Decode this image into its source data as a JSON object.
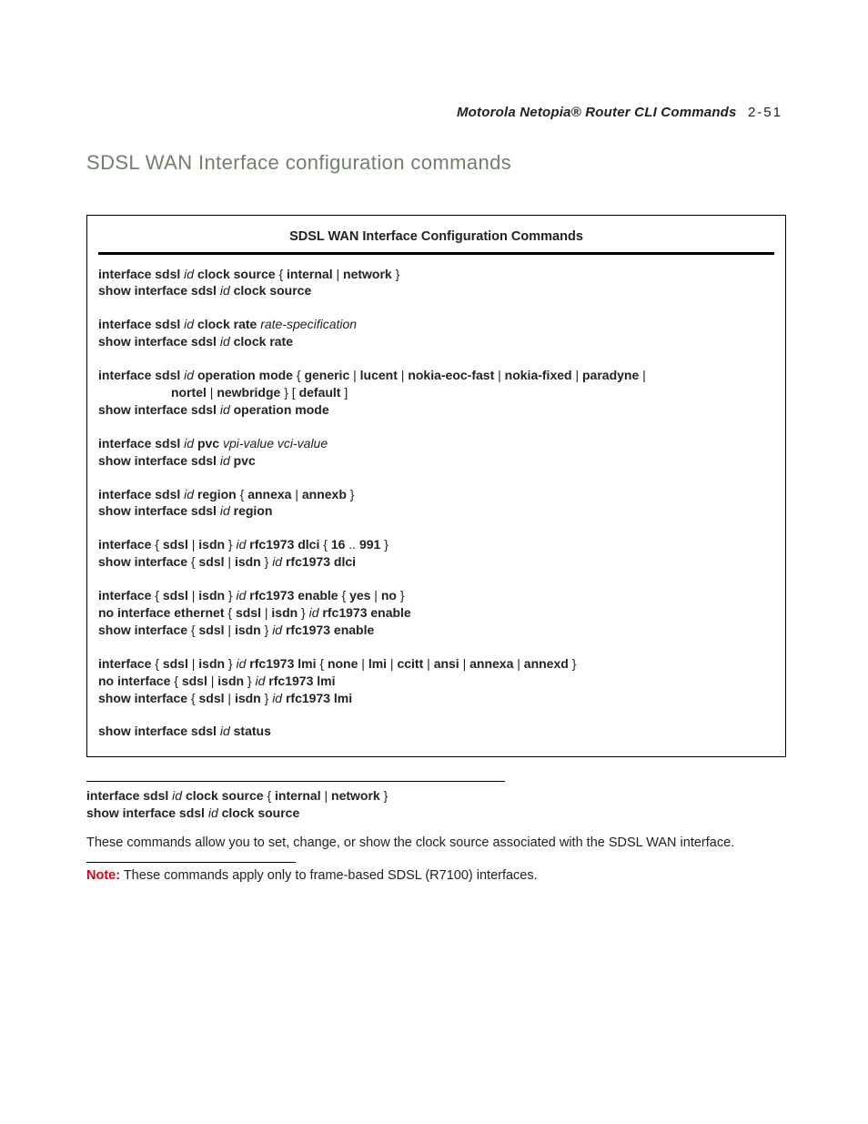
{
  "header": {
    "running": "Motorola Netopia® Router CLI Commands",
    "pagenum": "2-51"
  },
  "heading": "SDSL WAN Interface configuration commands",
  "box": {
    "title": "SDSL WAN Interface Configuration Commands",
    "groups": [
      [
        {
          "segs": [
            [
              "b",
              "interface sdsl "
            ],
            [
              "i",
              "id"
            ],
            [
              "b",
              " clock source "
            ],
            [
              "t",
              "{ "
            ],
            [
              "b",
              "internal"
            ],
            [
              "t",
              " | "
            ],
            [
              "b",
              "network"
            ],
            [
              "t",
              " }"
            ]
          ]
        },
        {
          "segs": [
            [
              "b",
              "show interface sdsl "
            ],
            [
              "i",
              "id"
            ],
            [
              "b",
              " clock source"
            ]
          ]
        }
      ],
      [
        {
          "segs": [
            [
              "b",
              "interface sdsl "
            ],
            [
              "i",
              "id"
            ],
            [
              "b",
              " clock rate "
            ],
            [
              "i",
              "rate-specification"
            ]
          ]
        },
        {
          "segs": [
            [
              "b",
              "show interface sdsl "
            ],
            [
              "i",
              "id"
            ],
            [
              "b",
              " clock rate"
            ]
          ]
        }
      ],
      [
        {
          "segs": [
            [
              "b",
              "interface sdsl "
            ],
            [
              "i",
              "id"
            ],
            [
              "b",
              " operation mode "
            ],
            [
              "t",
              "{ "
            ],
            [
              "b",
              "generic"
            ],
            [
              "t",
              " | "
            ],
            [
              "b",
              "lucent"
            ],
            [
              "t",
              " | "
            ],
            [
              "b",
              "nokia-eoc-fast"
            ],
            [
              "t",
              " | "
            ],
            [
              "b",
              "nokia-fixed"
            ],
            [
              "t",
              " | "
            ],
            [
              "b",
              "paradyne"
            ],
            [
              "t",
              " |"
            ]
          ]
        },
        {
          "indent": true,
          "segs": [
            [
              "b",
              "nortel"
            ],
            [
              "t",
              " | "
            ],
            [
              "b",
              "newbridge"
            ],
            [
              "t",
              " } [ "
            ],
            [
              "b",
              "default"
            ],
            [
              "t",
              " ]"
            ]
          ]
        },
        {
          "segs": [
            [
              "b",
              "show interface sdsl "
            ],
            [
              "i",
              "id"
            ],
            [
              "b",
              " operation mode"
            ]
          ]
        }
      ],
      [
        {
          "segs": [
            [
              "b",
              "interface sdsl "
            ],
            [
              "i",
              "id"
            ],
            [
              "b",
              " pvc "
            ],
            [
              "i",
              "vpi-value vci-value"
            ]
          ]
        },
        {
          "segs": [
            [
              "b",
              "show interface sdsl "
            ],
            [
              "i",
              "id"
            ],
            [
              "b",
              " pvc"
            ]
          ]
        }
      ],
      [
        {
          "segs": [
            [
              "b",
              "interface sdsl "
            ],
            [
              "i",
              "id"
            ],
            [
              "b",
              " region "
            ],
            [
              "t",
              "{ "
            ],
            [
              "b",
              "annexa"
            ],
            [
              "t",
              " |  "
            ],
            [
              "b",
              "annexb"
            ],
            [
              "t",
              " }"
            ]
          ]
        },
        {
          "segs": [
            [
              "b",
              "show interface sdsl "
            ],
            [
              "i",
              "id"
            ],
            [
              "b",
              " region"
            ]
          ]
        }
      ],
      [
        {
          "segs": [
            [
              "b",
              "interface "
            ],
            [
              "t",
              "{ "
            ],
            [
              "b",
              "sdsl"
            ],
            [
              "t",
              " | "
            ],
            [
              "b",
              "isdn"
            ],
            [
              "t",
              " } "
            ],
            [
              "i",
              "id"
            ],
            [
              "b",
              " rfc1973 dlci "
            ],
            [
              "t",
              "{ "
            ],
            [
              "b",
              "16"
            ],
            [
              "t",
              " .. "
            ],
            [
              "b",
              "991"
            ],
            [
              "t",
              " }"
            ]
          ]
        },
        {
          "segs": [
            [
              "b",
              "show interface "
            ],
            [
              "t",
              "{ "
            ],
            [
              "b",
              "sdsl"
            ],
            [
              "t",
              " | "
            ],
            [
              "b",
              "isdn"
            ],
            [
              "t",
              " } "
            ],
            [
              "i",
              "id"
            ],
            [
              "b",
              " rfc1973 dlci"
            ]
          ]
        }
      ],
      [
        {
          "segs": [
            [
              "b",
              "interface "
            ],
            [
              "t",
              "{ "
            ],
            [
              "b",
              "sdsl"
            ],
            [
              "t",
              " | "
            ],
            [
              "b",
              "isdn"
            ],
            [
              "t",
              " } "
            ],
            [
              "i",
              "id"
            ],
            [
              "b",
              " rfc1973 enable "
            ],
            [
              "t",
              "{ "
            ],
            [
              "b",
              "yes"
            ],
            [
              "t",
              " | "
            ],
            [
              "b",
              "no"
            ],
            [
              "t",
              " }"
            ]
          ]
        },
        {
          "segs": [
            [
              "b",
              "no interface ethernet "
            ],
            [
              "t",
              "{ "
            ],
            [
              "b",
              "sdsl"
            ],
            [
              "t",
              " | "
            ],
            [
              "b",
              "isdn"
            ],
            [
              "t",
              " } "
            ],
            [
              "i",
              "id"
            ],
            [
              "b",
              " rfc1973 enable"
            ]
          ]
        },
        {
          "segs": [
            [
              "b",
              "show interface "
            ],
            [
              "t",
              "{ "
            ],
            [
              "b",
              "sdsl"
            ],
            [
              "t",
              " | "
            ],
            [
              "b",
              "isdn "
            ],
            [
              "t",
              " } "
            ],
            [
              "i",
              "id"
            ],
            [
              "b",
              " rfc1973 enable"
            ]
          ]
        }
      ],
      [
        {
          "segs": [
            [
              "b",
              "interface "
            ],
            [
              "t",
              "{ "
            ],
            [
              "b",
              "sdsl"
            ],
            [
              "t",
              " | "
            ],
            [
              "b",
              "isdn"
            ],
            [
              "t",
              " } "
            ],
            [
              "i",
              "id"
            ],
            [
              "b",
              " rfc1973 lmi "
            ],
            [
              "t",
              "{ "
            ],
            [
              "b",
              "none"
            ],
            [
              "t",
              " | "
            ],
            [
              "b",
              "lmi"
            ],
            [
              "t",
              " | "
            ],
            [
              "b",
              "ccitt"
            ],
            [
              "t",
              " | "
            ],
            [
              "b",
              "ansi"
            ],
            [
              "t",
              " | "
            ],
            [
              "b",
              "annexa"
            ],
            [
              "t",
              " | "
            ],
            [
              "b",
              "annexd"
            ],
            [
              "t",
              " }"
            ]
          ]
        },
        {
          "segs": [
            [
              "b",
              "no interface "
            ],
            [
              "t",
              "{ "
            ],
            [
              "b",
              "sdsl"
            ],
            [
              "t",
              " | "
            ],
            [
              "b",
              "isdn"
            ],
            [
              "t",
              " } "
            ],
            [
              "i",
              "id"
            ],
            [
              "b",
              " rfc1973 lmi"
            ]
          ]
        },
        {
          "segs": [
            [
              "b",
              "show interface "
            ],
            [
              "t",
              "{ "
            ],
            [
              "b",
              "sdsl"
            ],
            [
              "t",
              " | "
            ],
            [
              "b",
              "isdn"
            ],
            [
              "t",
              " } "
            ],
            [
              "i",
              "id"
            ],
            [
              "b",
              " rfc1973 lmi"
            ]
          ]
        }
      ],
      [
        {
          "segs": [
            [
              "b",
              "show interface sdsl "
            ],
            [
              "i",
              "id"
            ],
            [
              "b",
              " status"
            ]
          ]
        }
      ]
    ]
  },
  "sub": {
    "lines": [
      {
        "segs": [
          [
            "b",
            "interface sdsl "
          ],
          [
            "i",
            "id"
          ],
          [
            "b",
            " clock source "
          ],
          [
            "t",
            "{ "
          ],
          [
            "b",
            "internal"
          ],
          [
            "t",
            " | "
          ],
          [
            "b",
            "network"
          ],
          [
            "t",
            " }"
          ]
        ]
      },
      {
        "segs": [
          [
            "b",
            "show interface sdsl "
          ],
          [
            "i",
            "id"
          ],
          [
            "b",
            " clock source"
          ]
        ]
      }
    ],
    "body": "These commands allow you to set, change, or show the clock source associated with the SDSL WAN interface.",
    "note_label": "Note:",
    "note_text": "  These commands apply only to frame-based SDSL (R7100) interfaces."
  }
}
